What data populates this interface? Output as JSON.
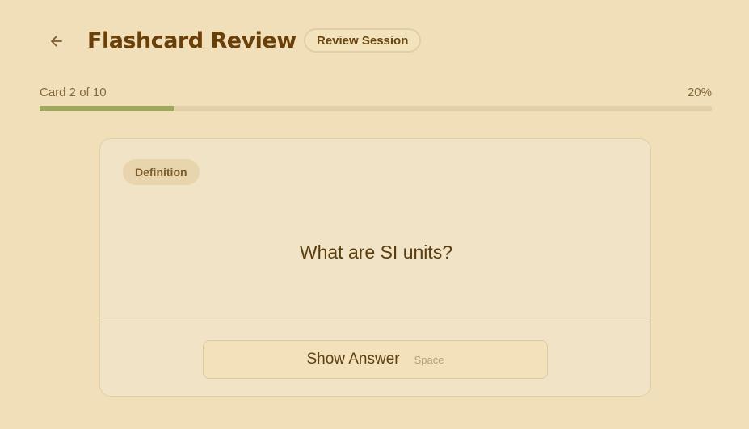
{
  "header": {
    "title": "Flashcard Review",
    "badge": "Review Session",
    "back_icon": "arrow-left-icon"
  },
  "progress": {
    "label": "Card 2 of 10",
    "percent_text": "20%",
    "fraction": 0.2,
    "fill_color": "#a0a65d",
    "track_color": "#e3cfa6"
  },
  "card": {
    "tag": "Definition",
    "question": "What are SI units?",
    "show_answer_label": "Show Answer",
    "shortcut": "Space"
  },
  "colors": {
    "background": "#f0dfb8",
    "title": "#6a3f08",
    "card_background": "#f1e3c6"
  }
}
